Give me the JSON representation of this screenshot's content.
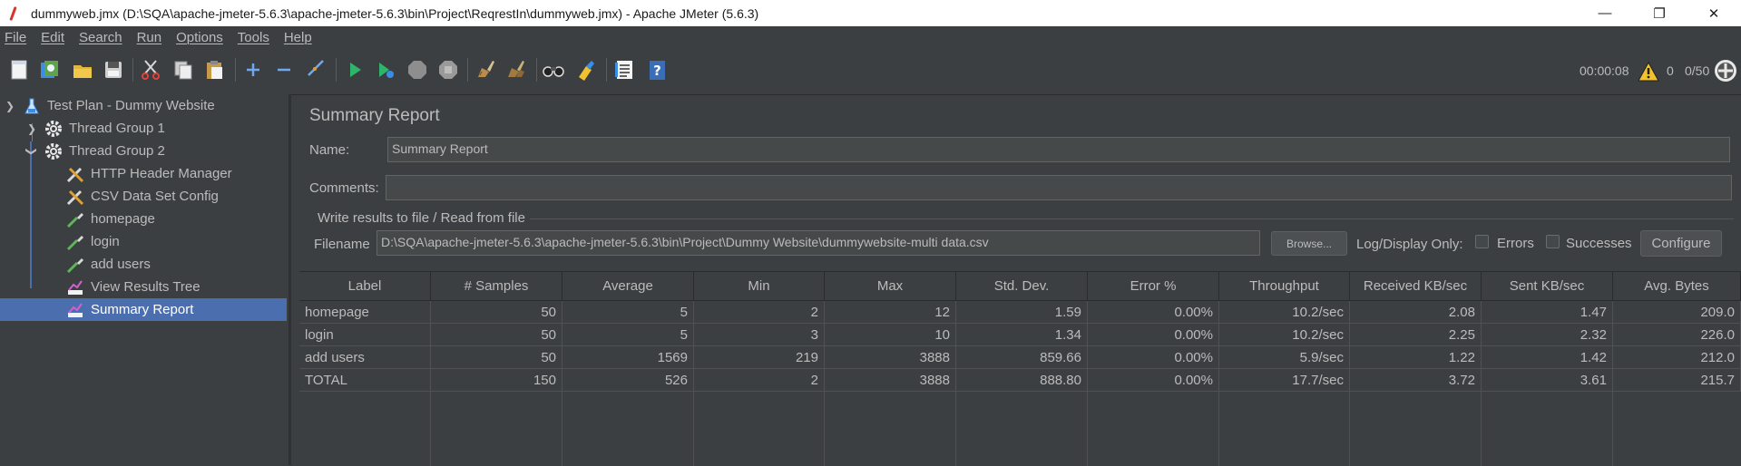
{
  "window": {
    "title": "dummyweb.jmx (D:\\SQA\\apache-jmeter-5.6.3\\apache-jmeter-5.6.3\\bin\\Project\\ReqrestIn\\dummyweb.jmx) - Apache JMeter (5.6.3)",
    "minimize": "—",
    "restore": "❐",
    "close": "✕"
  },
  "menu": [
    "File",
    "Edit",
    "Search",
    "Run",
    "Options",
    "Tools",
    "Help"
  ],
  "toolbar": {
    "icons": [
      "new-icon",
      "templates-icon",
      "open-icon",
      "save-icon",
      "cut-icon",
      "copy-icon",
      "paste-icon",
      "expand-icon",
      "collapse-icon",
      "toggle-icon",
      "start-icon",
      "start-no-pauses-icon",
      "stop-icon",
      "shutdown-icon",
      "clear-icon",
      "clear-all-icon",
      "search-icon",
      "reset-search-icon",
      "function-helper-icon",
      "help-icon"
    ],
    "elapsed": "00:00:08",
    "warnings": "0",
    "threads": "0/50"
  },
  "tree": {
    "items": [
      {
        "label": "Test Plan - Dummy Website",
        "icon": "test-plan-icon"
      },
      {
        "label": "Thread Group 1",
        "icon": "gear-icon"
      },
      {
        "label": "Thread Group 2",
        "icon": "gear-icon"
      },
      {
        "label": "HTTP Header Manager",
        "icon": "config-tools-icon"
      },
      {
        "label": "CSV Data Set Config",
        "icon": "config-tools-icon"
      },
      {
        "label": "homepage",
        "icon": "sampler-pipette-icon"
      },
      {
        "label": "login",
        "icon": "sampler-pipette-icon"
      },
      {
        "label": "add users",
        "icon": "sampler-pipette-icon"
      },
      {
        "label": "View Results Tree",
        "icon": "listener-graph-icon"
      },
      {
        "label": "Summary Report",
        "icon": "listener-graph-icon"
      }
    ]
  },
  "panel": {
    "title": "Summary Report",
    "name_label": "Name:",
    "name_value": "Summary Report",
    "comments_label": "Comments:",
    "comments_value": "",
    "file_section": "Write results to file / Read from file",
    "filename_label": "Filename",
    "filename_value": "D:\\SQA\\apache-jmeter-5.6.3\\apache-jmeter-5.6.3\\bin\\Project\\Dummy Website\\dummywebsite-multi data.csv",
    "browse": "Browse...",
    "log_display": "Log/Display Only:",
    "errors": "Errors",
    "successes": "Successes",
    "configure": "Configure"
  },
  "table": {
    "headers": [
      "Label",
      "# Samples",
      "Average",
      "Min",
      "Max",
      "Std. Dev.",
      "Error %",
      "Throughput",
      "Received KB/sec",
      "Sent KB/sec",
      "Avg. Bytes"
    ],
    "rows": [
      [
        "homepage",
        "50",
        "5",
        "2",
        "12",
        "1.59",
        "0.00%",
        "10.2/sec",
        "2.08",
        "1.47",
        "209.0"
      ],
      [
        "login",
        "50",
        "5",
        "3",
        "10",
        "1.34",
        "0.00%",
        "10.2/sec",
        "2.25",
        "2.32",
        "226.0"
      ],
      [
        "add users",
        "50",
        "1569",
        "219",
        "3888",
        "859.66",
        "0.00%",
        "5.9/sec",
        "1.22",
        "1.42",
        "212.0"
      ],
      [
        "TOTAL",
        "150",
        "526",
        "2",
        "3888",
        "888.80",
        "0.00%",
        "17.7/sec",
        "3.72",
        "3.61",
        "215.7"
      ]
    ]
  },
  "colors": {
    "background": "#3c3f41",
    "selection": "#4b6eaf",
    "text": "#bbbbbb",
    "field": "#45494a"
  }
}
